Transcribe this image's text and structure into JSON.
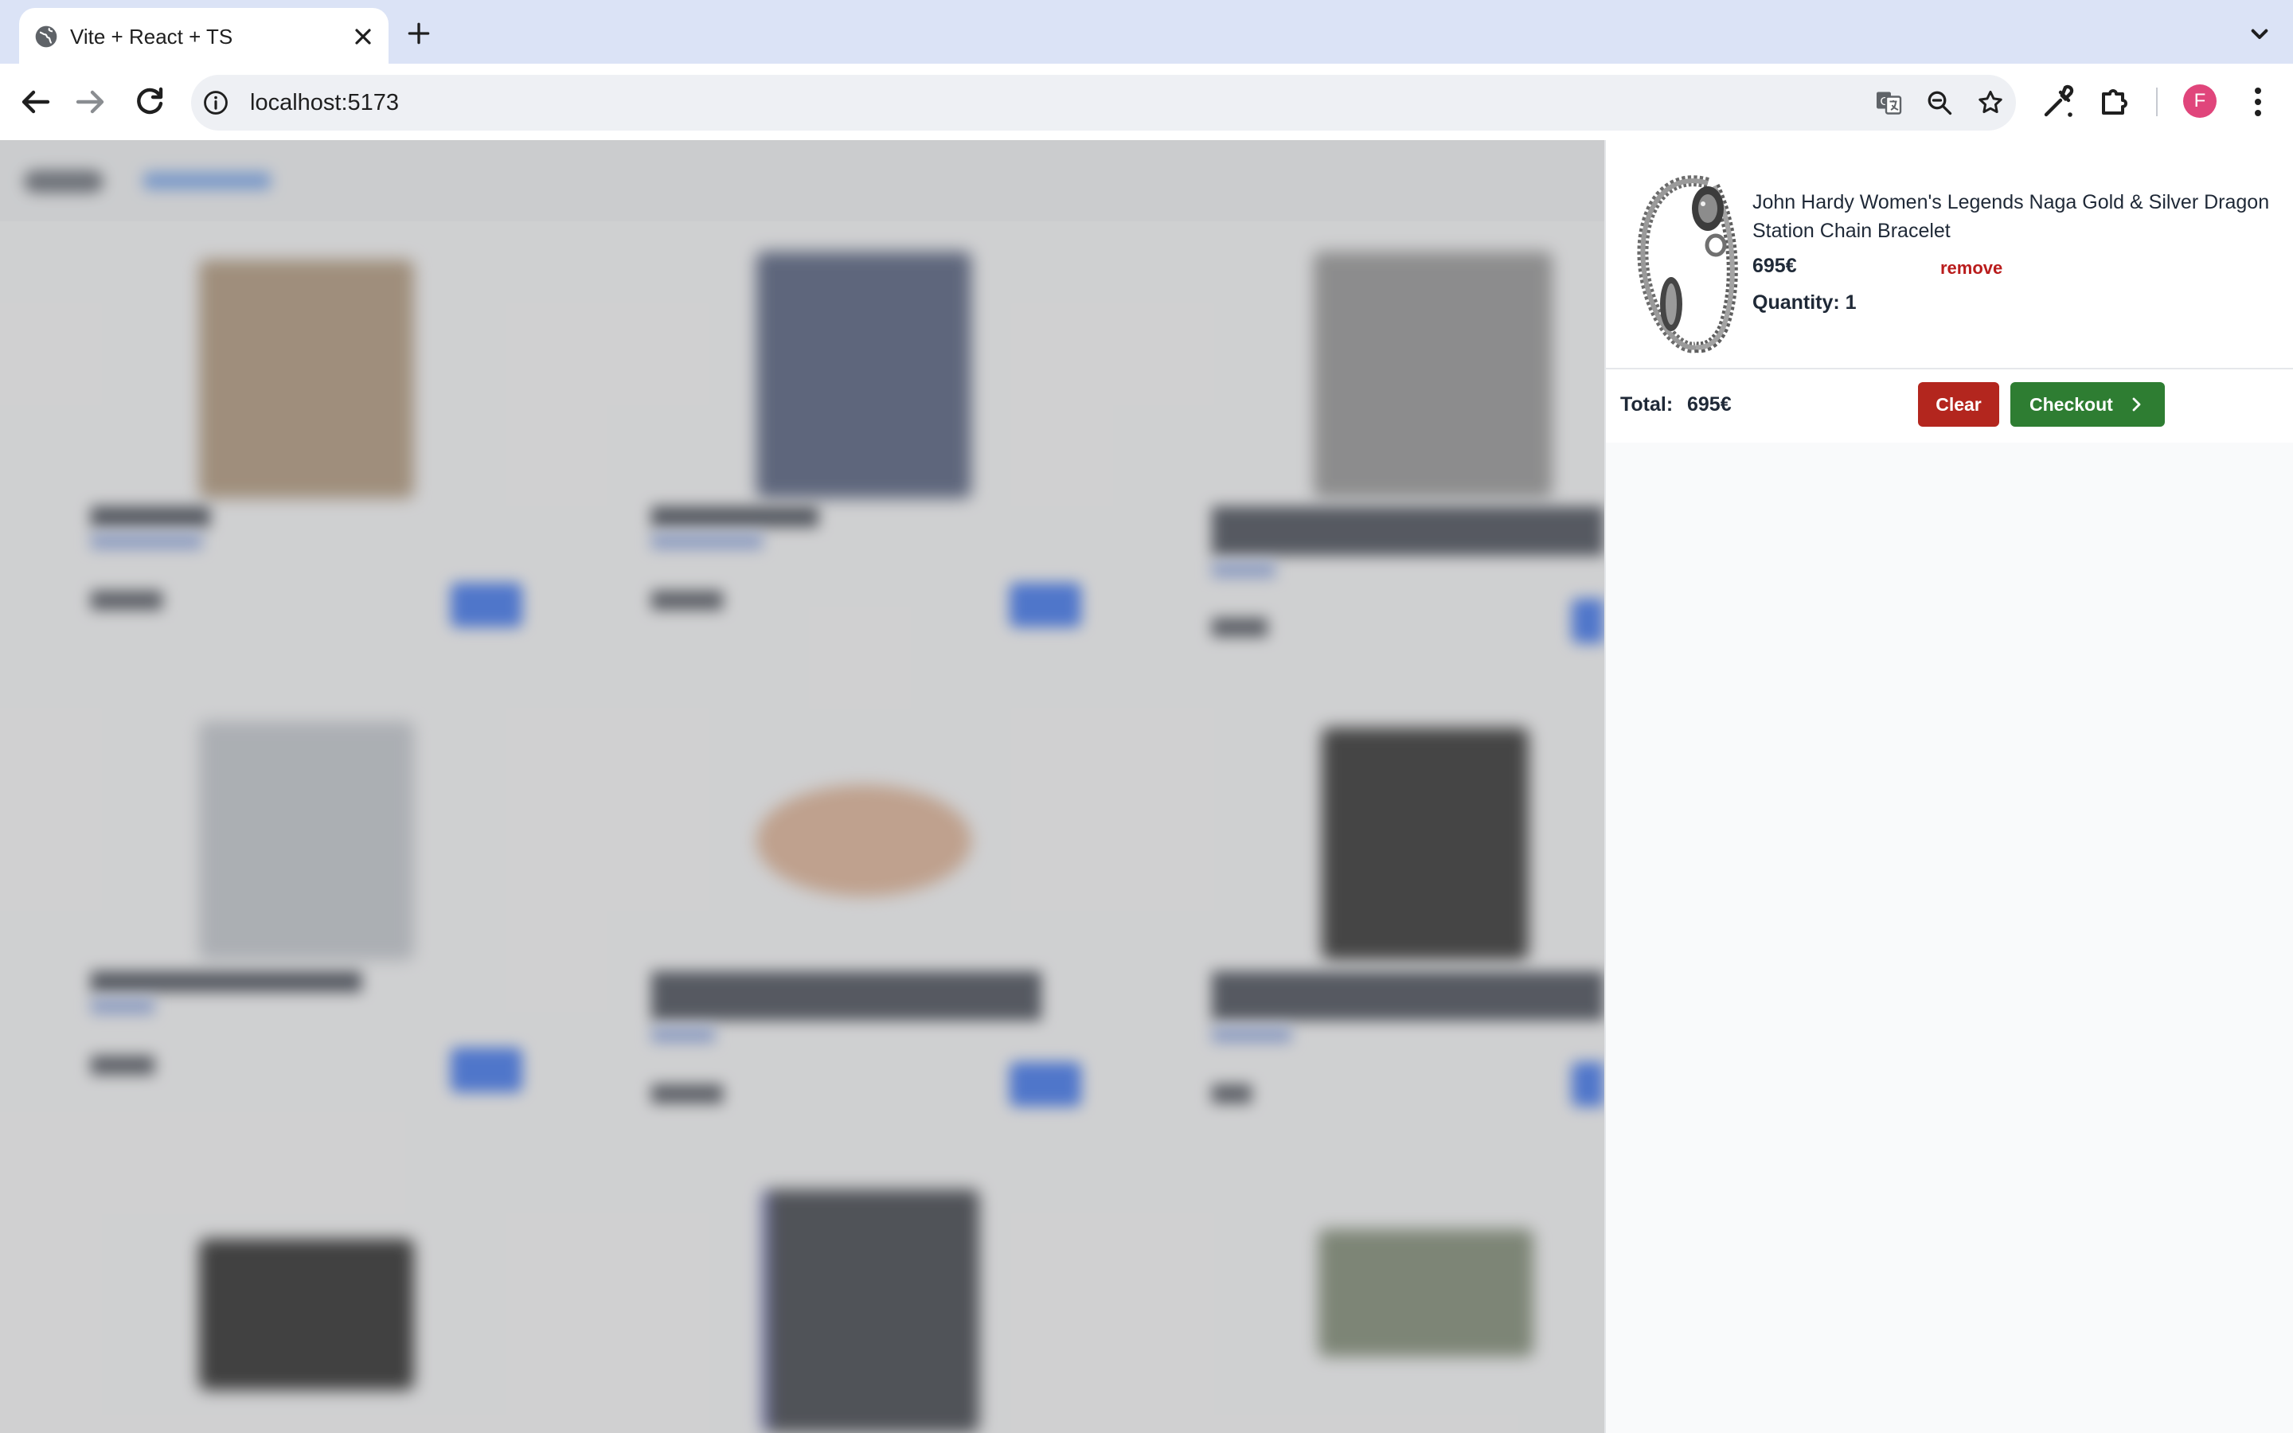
{
  "browser": {
    "tab_title": "Vite + React + TS",
    "url": "localhost:5173",
    "profile_initial": "F"
  },
  "cart": {
    "item": {
      "name": "John Hardy Women's Legends Naga Gold & Silver Dragon Station Chain Bracelet",
      "price": "695€",
      "remove_label": "remove",
      "quantity_label": "Quantity: 1"
    },
    "total_label": "Total:",
    "total_value": "695€",
    "clear_label": "Clear",
    "checkout_label": "Checkout"
  },
  "colors": {
    "clear_button": "#b3261e",
    "checkout_button": "#2e7d32",
    "remove_link": "#b91c1c",
    "tabstrip": "#dbe3f6",
    "avatar": "#e0457b"
  },
  "icons": [
    "globe-icon",
    "close-icon",
    "plus-icon",
    "chevron-down-icon",
    "back-arrow-icon",
    "forward-arrow-icon",
    "reload-icon",
    "site-info-icon",
    "translate-icon",
    "zoom-icon",
    "star-icon",
    "eyedropper-icon",
    "extensions-icon",
    "kebab-menu-icon",
    "chevron-right-icon"
  ]
}
